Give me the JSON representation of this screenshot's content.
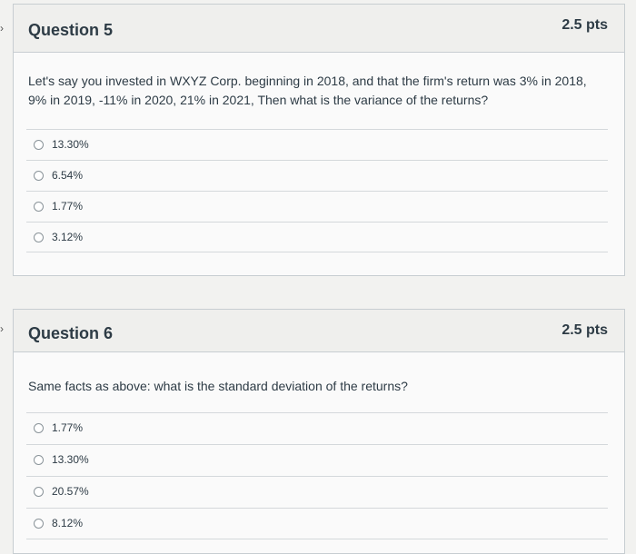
{
  "questions": [
    {
      "title": "Question 5",
      "points": "2.5 pts",
      "text": "Let's say you invested in WXYZ Corp. beginning in 2018, and that the firm's return was 3% in 2018, 9% in 2019, -11% in 2020, 21% in 2021, Then what is the variance of the returns?",
      "answers": [
        "13.30%",
        "6.54%",
        "1.77%",
        "3.12%"
      ]
    },
    {
      "title": "Question 6",
      "points": "2.5 pts",
      "text": "Same facts as above: what is the standard deviation of the returns?",
      "answers": [
        "1.77%",
        "13.30%",
        "20.57%",
        "8.12%"
      ]
    }
  ],
  "icons": {
    "question_marker": "chevron-right-icon",
    "answer_choice": "radio-button-icon"
  }
}
